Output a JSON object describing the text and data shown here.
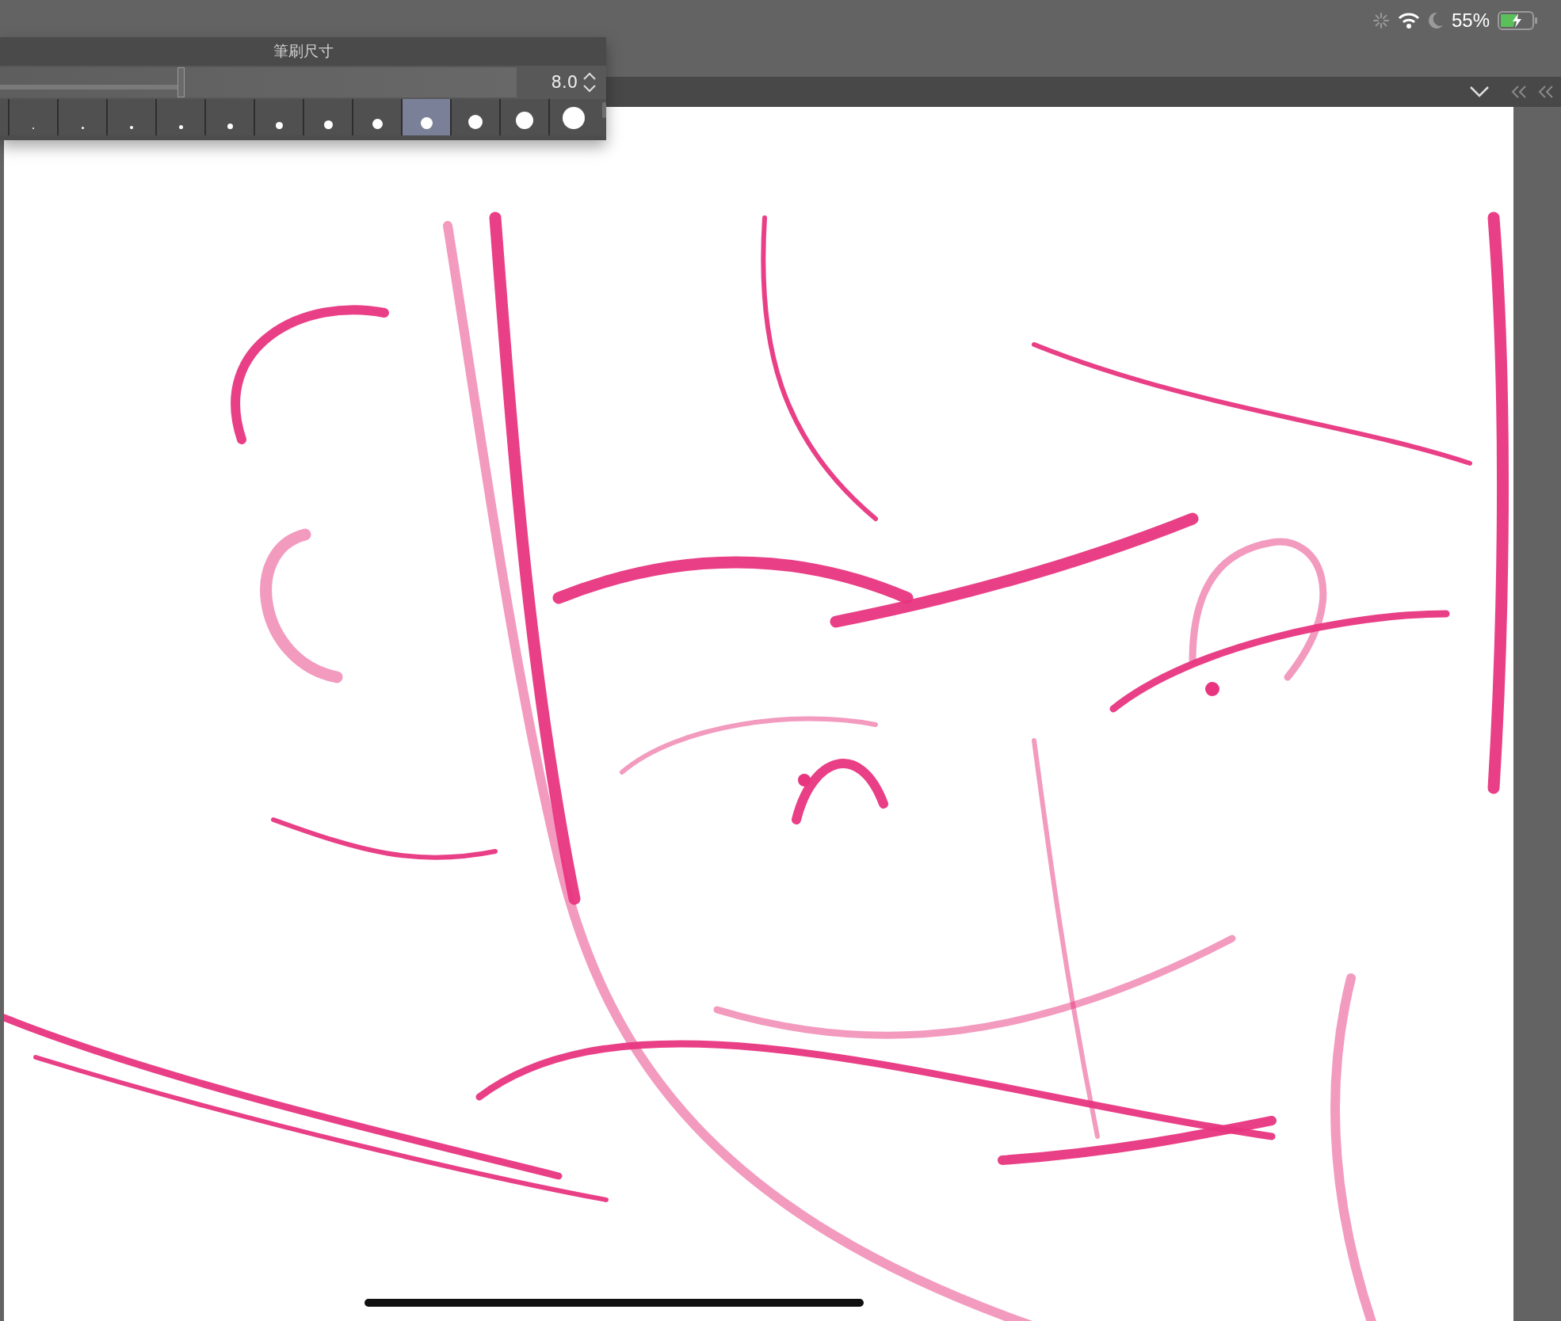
{
  "status_bar": {
    "battery": "55%"
  },
  "brush_size_panel": {
    "title": "筆刷尺寸",
    "slider": {
      "level": 0.35,
      "value": "8.0"
    },
    "presets": [
      {
        "selected": false
      },
      {
        "selected": false
      },
      {
        "selected": false
      },
      {
        "selected": false
      },
      {
        "selected": false
      },
      {
        "selected": false
      },
      {
        "selected": false
      },
      {
        "selected": false
      },
      {
        "selected": true
      },
      {
        "selected": false
      },
      {
        "selected": false
      },
      {
        "selected": false
      }
    ]
  }
}
